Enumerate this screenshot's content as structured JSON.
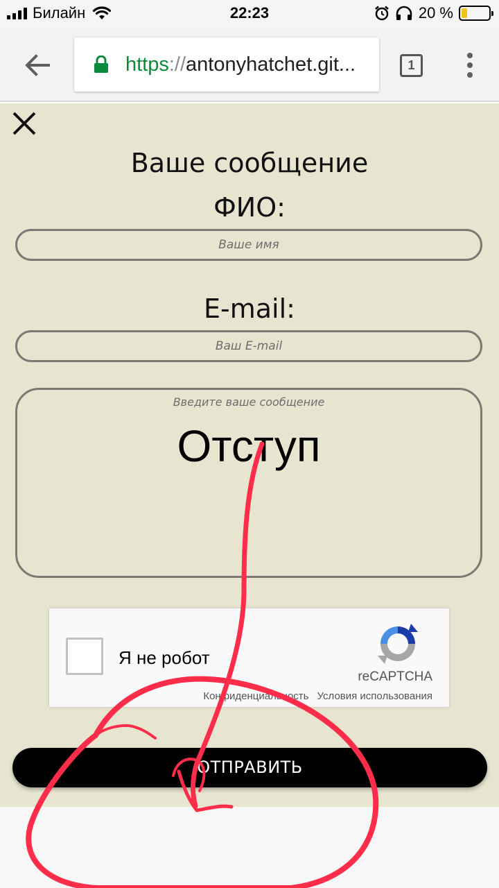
{
  "status_bar": {
    "carrier": "Билайн",
    "time": "22:23",
    "battery_percent": "20 %",
    "battery_level": 0.2,
    "icons": [
      "signal-icon",
      "wifi-icon",
      "alarm-icon",
      "headphones-icon",
      "battery-icon"
    ]
  },
  "browser": {
    "url_scheme": "https",
    "url_separator": "://",
    "url_host": "antonyhatchet.git...",
    "tab_count": "1",
    "accent_color": "#0a8a3c"
  },
  "form": {
    "title": "Ваше сообщение",
    "name_label": "ФИО:",
    "name_placeholder": "Ваше имя",
    "email_label": "E-mail:",
    "email_placeholder": "Ваш E-mail",
    "message_placeholder": "Введите ваше сообщение",
    "message_text": "Отступ",
    "submit_label": "ОТПРАВИТЬ",
    "background_color": "#e7e5d0"
  },
  "recaptcha": {
    "checkbox_label": "Я не робот",
    "brand": "reCAPTCHA",
    "privacy_link": "Конфиденциальность",
    "terms_link": "Условия использования"
  },
  "annotation": {
    "color": "#ff2d4a"
  }
}
